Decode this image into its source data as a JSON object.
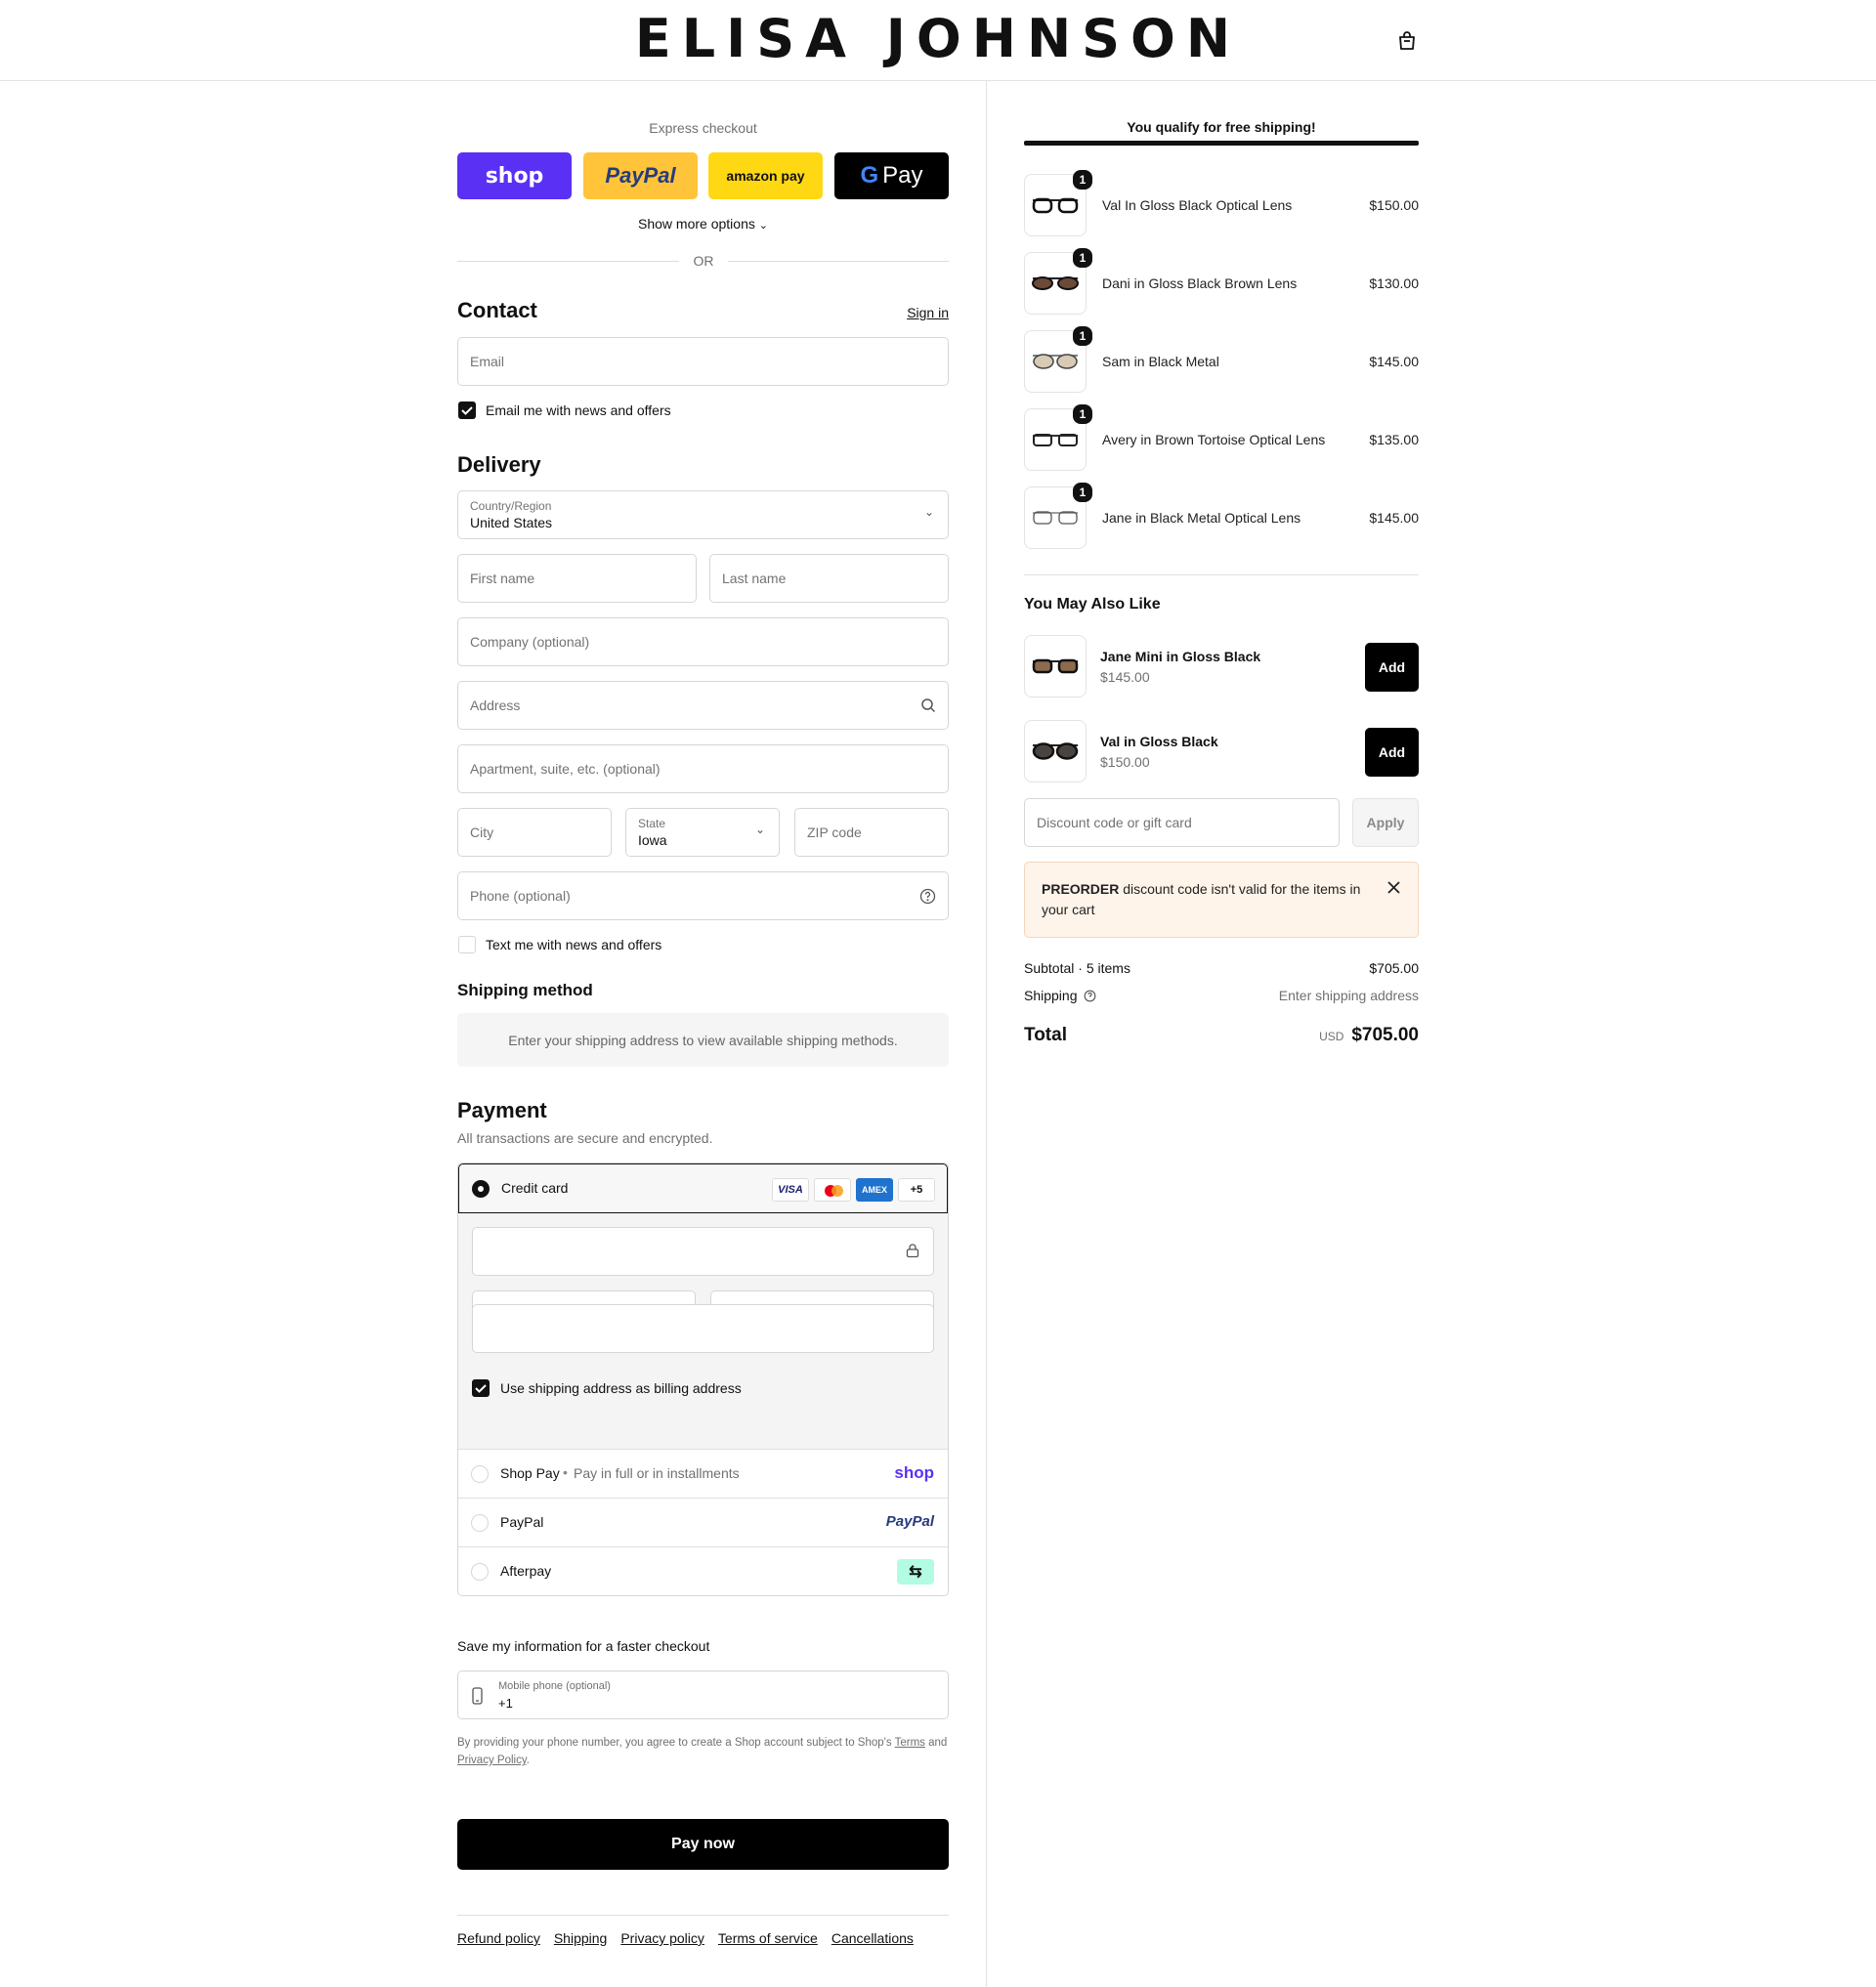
{
  "brand": {
    "name": "ELISA JOHNSON"
  },
  "express": {
    "title": "Express checkout",
    "shop_label": "shop",
    "paypal_label": "PayPal",
    "amazon_label": "amazon pay",
    "gpay_label": "Pay",
    "more_options": "Show more options",
    "or": "OR"
  },
  "contact": {
    "title": "Contact",
    "sign_in": "Sign in",
    "email_placeholder": "Email",
    "news_label": "Email me with news and offers",
    "news_checked": true
  },
  "delivery": {
    "title": "Delivery",
    "country_label": "Country/Region",
    "country_value": "United States",
    "first_name": "First name",
    "last_name": "Last name",
    "company": "Company (optional)",
    "address": "Address",
    "apartment": "Apartment, suite, etc. (optional)",
    "city": "City",
    "state_label": "State",
    "state_value": "Iowa",
    "zip": "ZIP code",
    "phone": "Phone (optional)",
    "text_label": "Text me with news and offers",
    "text_checked": false
  },
  "shipping_method": {
    "title": "Shipping method",
    "message": "Enter your shipping address to view available shipping methods."
  },
  "payment": {
    "title": "Payment",
    "subtitle": "All transactions are secure and encrypted.",
    "credit_card_label": "Credit card",
    "card_brands": [
      "VISA",
      "Mastercard",
      "AMEX",
      "+5"
    ],
    "billing_label": "Use shipping address as billing address",
    "billing_checked": true,
    "shop_pay_label": "Shop Pay",
    "shop_pay_sub": "Pay in full or in installments",
    "shop_pay_logo": "shop",
    "paypal_label": "PayPal",
    "paypal_logo": "PayPal",
    "afterpay_label": "Afterpay"
  },
  "save_info": {
    "title": "Save my information for a faster checkout",
    "phone_label": "Mobile phone (optional)",
    "phone_value": "+1",
    "legal_prefix": "By providing your phone number, you agree to create a Shop account subject to Shop's",
    "terms_link": "Terms",
    "and": "and",
    "privacy_link": "Privacy Policy",
    "period": "."
  },
  "pay_now": "Pay now",
  "footer_links": [
    "Refund policy",
    "Shipping",
    "Privacy policy",
    "Terms of service",
    "Cancellations"
  ],
  "summary": {
    "free_shipping": "You qualify for free shipping!",
    "items": [
      {
        "name": "Val In Gloss Black Optical Lens",
        "price": "$150.00",
        "qty": "1"
      },
      {
        "name": "Dani in Gloss Black Brown Lens",
        "price": "$130.00",
        "qty": "1"
      },
      {
        "name": "Sam in Black Metal",
        "price": "$145.00",
        "qty": "1"
      },
      {
        "name": "Avery in Brown Tortoise Optical Lens",
        "price": "$135.00",
        "qty": "1"
      },
      {
        "name": "Jane in Black Metal Optical Lens",
        "price": "$145.00",
        "qty": "1"
      }
    ],
    "upsell_title": "You May Also Like",
    "upsell": [
      {
        "name": "Jane Mini in Gloss Black",
        "price": "$145.00",
        "button": "Add"
      },
      {
        "name": "Val in Gloss Black",
        "price": "$150.00",
        "button": "Add"
      }
    ],
    "discount_placeholder": "Discount code or gift card",
    "apply": "Apply",
    "error_code": "PREORDER",
    "error_message": "discount code isn't valid for the items in your cart",
    "subtotal_label": "Subtotal · 5 items",
    "subtotal_value": "$705.00",
    "shipping_label": "Shipping",
    "shipping_value": "Enter shipping address",
    "total_label": "Total",
    "currency": "USD",
    "total_value": "$705.00"
  },
  "colors": {
    "shop_purple": "#5a31f4",
    "paypal_yellow": "#ffc439",
    "amazon_yellow": "#ffd814",
    "black": "#000000",
    "error_bg": "#fff4ea",
    "afterpay_mint": "#b2fce4"
  }
}
